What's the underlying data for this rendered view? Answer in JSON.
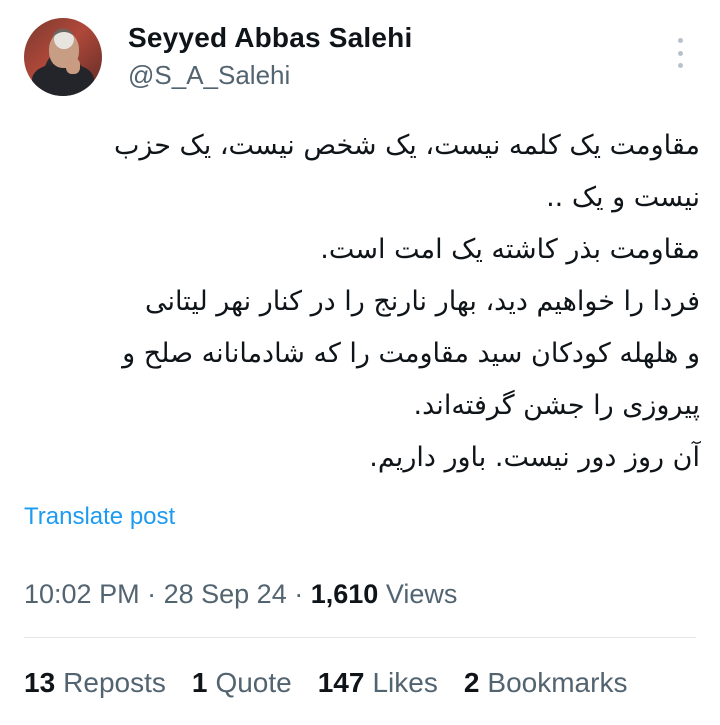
{
  "author": {
    "name": "Seyyed Abbas Salehi",
    "handle": "@S_A_Salehi"
  },
  "tweet": {
    "lines": [
      "مقاومت یک کلمه نیست، یک شخص نیست، یک حزب",
      "نیست و یک ..",
      "مقاومت بذر کاشته یک امت است.",
      "فردا را خواهیم دید، بهار نارنج را در کنار نهر لیتانی",
      "و هلهله کودکان سید مقاومت را که شادمانانه صلح و",
      "پیروزی را جشن گرفته‌اند.",
      "آن روز دور نیست. باور داریم."
    ]
  },
  "translate_label": "Translate post",
  "meta": {
    "time": "10:02 PM",
    "separator": "·",
    "date": "28 Sep 24",
    "views_count": "1,610",
    "views_label": "Views"
  },
  "stats": {
    "reposts": {
      "count": "13",
      "label": "Reposts"
    },
    "quotes": {
      "count": "1",
      "label": "Quote"
    },
    "likes": {
      "count": "147",
      "label": "Likes"
    },
    "bookmarks": {
      "count": "2",
      "label": "Bookmarks"
    }
  },
  "colors": {
    "link": "#1d9bf0",
    "secondary_text": "#536471",
    "primary_text": "#0f1419"
  },
  "icons": {
    "more": "more-vertical-icon"
  }
}
